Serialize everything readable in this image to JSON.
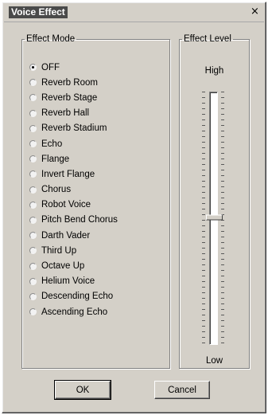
{
  "window": {
    "title": "Voice Effect",
    "close_glyph": "×"
  },
  "effect_mode": {
    "legend": "Effect Mode",
    "selected": "OFF",
    "options": [
      "OFF",
      "Reverb Room",
      "Reverb Stage",
      "Reverb Hall",
      "Reverb Stadium",
      "Echo",
      "Flange",
      "Invert Flange",
      "Chorus",
      "Robot Voice",
      "Pitch Bend Chorus",
      "Darth Vader",
      "Third Up",
      "Octave Up",
      "Helium Voice",
      "Descending Echo",
      "Ascending Echo"
    ]
  },
  "effect_level": {
    "legend": "Effect Level",
    "high_label": "High",
    "low_label": "Low",
    "value_fraction": 0.5
  },
  "buttons": {
    "ok_label": "OK",
    "cancel_label": "Cancel"
  }
}
